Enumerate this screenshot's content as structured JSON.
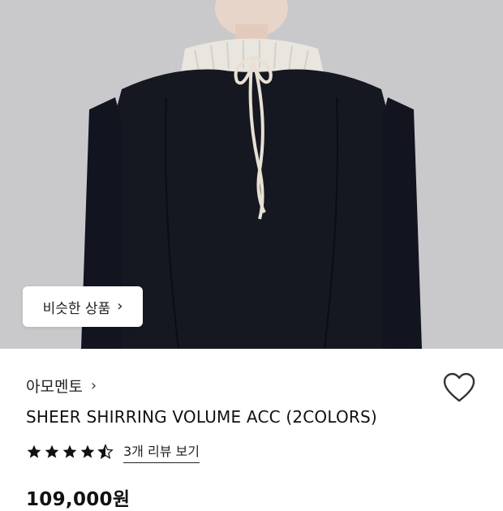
{
  "hero": {
    "image_alt": "model wearing black long blouse with sheer ruffled collar and drawstring tie",
    "similar_button": {
      "label": "비슷한 상품",
      "icon": "chevron-right-icon"
    }
  },
  "product": {
    "brand": "아모멘토",
    "brand_icon": "chevron-right-icon",
    "title": "SHEER SHIRRING VOLUME ACC (2COLORS)",
    "rating": {
      "value": 4.5,
      "max": 5,
      "review_link": "3개 리뷰 보기"
    },
    "price": "109,000원",
    "wishlist_icon": "heart-outline-icon"
  },
  "colors": {
    "hero_bg": "#c9c9cb",
    "garment": "#151821",
    "text": "#111111"
  }
}
